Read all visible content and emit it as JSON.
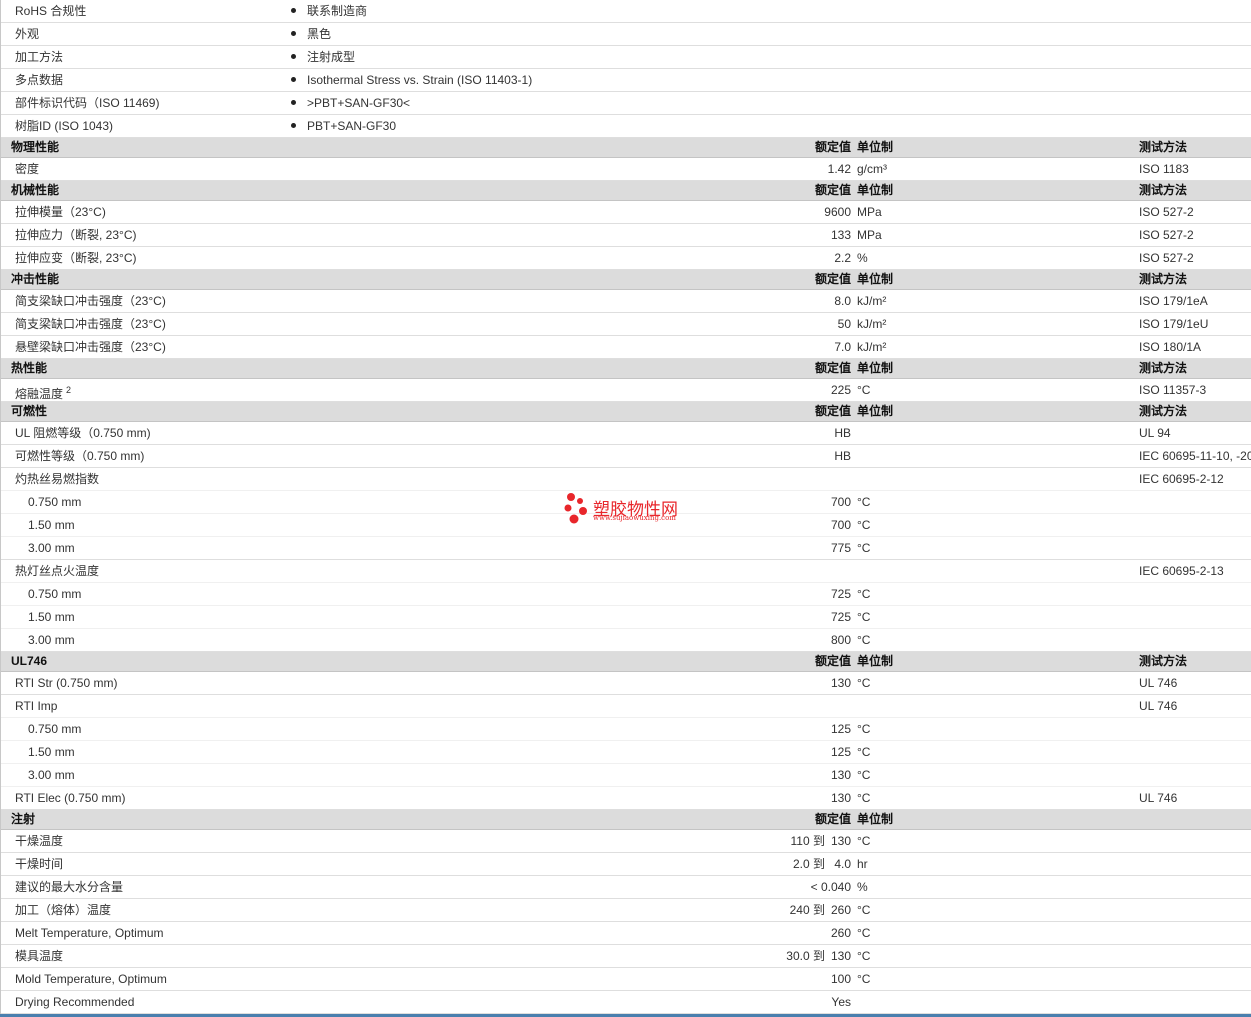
{
  "general": [
    {
      "label": "RoHS 合规性",
      "value": "联系制造商"
    },
    {
      "label": "外观",
      "value": "黑色"
    },
    {
      "label": "加工方法",
      "value": "注射成型"
    },
    {
      "label": "多点数据",
      "value": "Isothermal Stress vs. Strain (ISO 11403-1)"
    },
    {
      "label": "部件标识代码（ISO 11469)",
      "value": ">PBT+SAN-GF30<"
    },
    {
      "label": "树脂ID (ISO 1043)",
      "value": "PBT+SAN-GF30"
    }
  ],
  "col_headers": {
    "value": "额定值",
    "unit": "单位制",
    "method": "测试方法"
  },
  "physical": {
    "title": "物理性能",
    "rows": [
      {
        "label": "密度",
        "value": "1.42",
        "unit": "g/cm³",
        "method": "ISO 1183"
      }
    ]
  },
  "mechanical": {
    "title": "机械性能",
    "rows": [
      {
        "label": "拉伸模量（23°C)",
        "value": "9600",
        "unit": "MPa",
        "method": "ISO 527-2"
      },
      {
        "label": "拉伸应力（断裂, 23°C)",
        "value": "133",
        "unit": "MPa",
        "method": "ISO 527-2"
      },
      {
        "label": "拉伸应变（断裂, 23°C)",
        "value": "2.2",
        "unit": "%",
        "method": "ISO 527-2"
      }
    ]
  },
  "impact": {
    "title": "冲击性能",
    "rows": [
      {
        "label": "简支梁缺口冲击强度（23°C)",
        "value": "8.0",
        "unit": "kJ/m²",
        "method": "ISO 179/1eA"
      },
      {
        "label": "简支梁缺口冲击强度（23°C)",
        "value": "50",
        "unit": "kJ/m²",
        "method": "ISO 179/1eU"
      },
      {
        "label": "悬壁梁缺口冲击强度（23°C)",
        "value": "7.0",
        "unit": "kJ/m²",
        "method": "ISO 180/1A"
      }
    ]
  },
  "thermal": {
    "title": "热性能",
    "rows": [
      {
        "label": "熔融温度",
        "sup": "2",
        "value": "225",
        "unit": "°C",
        "method": "ISO 11357-3"
      }
    ]
  },
  "flammability": {
    "title": "可燃性",
    "rows": [
      {
        "label": "UL 阻燃等级（0.750 mm)",
        "value": "HB",
        "unit": "",
        "method": "UL 94"
      },
      {
        "label": "可燃性等级（0.750 mm)",
        "value": "HB",
        "unit": "",
        "method": "IEC 60695-11-10, -20"
      }
    ],
    "gwfi": {
      "label": "灼热丝易燃指数",
      "method": "IEC 60695-2-12",
      "rows": [
        {
          "label": "0.750 mm",
          "value": "700",
          "unit": "°C"
        },
        {
          "label": "1.50 mm",
          "value": "700",
          "unit": "°C"
        },
        {
          "label": "3.00 mm",
          "value": "775",
          "unit": "°C"
        }
      ]
    },
    "gwit": {
      "label": "热灯丝点火温度",
      "method": "IEC 60695-2-13",
      "rows": [
        {
          "label": "0.750 mm",
          "value": "725",
          "unit": "°C"
        },
        {
          "label": "1.50 mm",
          "value": "725",
          "unit": "°C"
        },
        {
          "label": "3.00 mm",
          "value": "800",
          "unit": "°C"
        }
      ]
    }
  },
  "ul746": {
    "title": "UL746",
    "rti_str": {
      "label": "RTI Str (0.750 mm)",
      "value": "130",
      "unit": "°C",
      "method": "UL 746"
    },
    "rti_imp": {
      "label": "RTI Imp",
      "method": "UL 746",
      "rows": [
        {
          "label": "0.750 mm",
          "value": "125",
          "unit": "°C"
        },
        {
          "label": "1.50 mm",
          "value": "125",
          "unit": "°C"
        },
        {
          "label": "3.00 mm",
          "value": "130",
          "unit": "°C"
        }
      ]
    },
    "rti_elec": {
      "label": "RTI Elec (0.750 mm)",
      "value": "130",
      "unit": "°C",
      "method": "UL 746"
    }
  },
  "injection": {
    "title": "注射",
    "rows": [
      {
        "label": "干燥温度",
        "from": "110",
        "to_word": "到",
        "value": "130",
        "unit": "°C"
      },
      {
        "label": "干燥时间",
        "from": "2.0",
        "to_word": "到",
        "value": "4.0",
        "unit": "hr"
      },
      {
        "label": "建议的最大水分含量",
        "value": "< 0.040",
        "unit": "%"
      },
      {
        "label": "加工（熔体）温度",
        "from": "240",
        "to_word": "到",
        "value": "260",
        "unit": "°C"
      },
      {
        "label": "Melt Temperature, Optimum",
        "value": "260",
        "unit": "°C"
      },
      {
        "label": "模具温度",
        "from": "30.0",
        "to_word": "到",
        "value": "130",
        "unit": "°C"
      },
      {
        "label": "Mold Temperature, Optimum",
        "value": "100",
        "unit": "°C"
      },
      {
        "label": "Drying Recommended",
        "value": "Yes",
        "unit": ""
      }
    ]
  },
  "watermark": {
    "name": "塑胶物性网",
    "url": "www.sujiaowuxing.com"
  },
  "colors": {
    "header_bg": "#dcdcdc",
    "logo_red": "#e8262b",
    "bottom_bar": "#4a7fae"
  }
}
